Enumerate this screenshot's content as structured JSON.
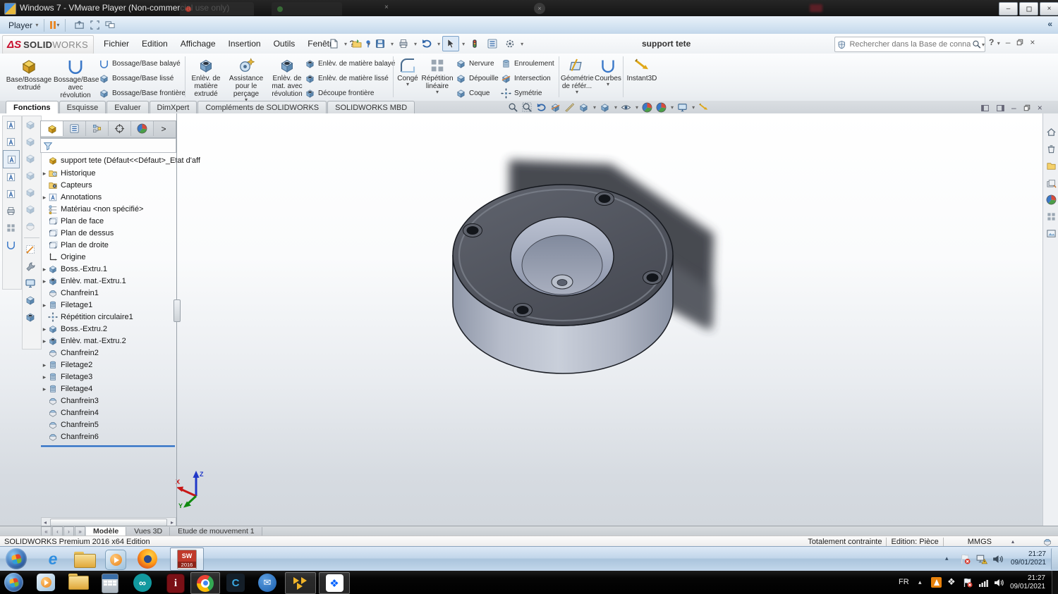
{
  "vmware": {
    "window_title": "Windows 7 - VMware Player (Non-commercial use only)",
    "player_menu": "Player"
  },
  "logo": {
    "mark": "ΔS",
    "bold": "SOLID",
    "light": "WORKS"
  },
  "menubar": {
    "menus": [
      "Fichier",
      "Edition",
      "Affichage",
      "Insertion",
      "Outils",
      "Fenêtre",
      "?"
    ],
    "doc_title": "support tete",
    "search_placeholder": "Rechercher dans la Base de connaissances"
  },
  "ribbon": {
    "large": [
      {
        "label": "Base/Bossage extrudé"
      },
      {
        "label": "Bossage/Base avec révolution"
      },
      {
        "label": "Enlèv. de matière extrudé"
      },
      {
        "label": "Assistance pour le perçage"
      },
      {
        "label": "Enlèv. de mat. avec révolution"
      },
      {
        "label": "Congé"
      },
      {
        "label": "Répétition linéaire"
      },
      {
        "label": "Géométrie de référ..."
      },
      {
        "label": "Courbes"
      },
      {
        "label": "Instant3D"
      }
    ],
    "small": [
      "Bossage/Base balayé",
      "Bossage/Base lissé",
      "Bossage/Base frontière",
      "Enlèv. de matière balayé",
      "Enlèv. de matière lissé",
      "Découpe frontière",
      "Nervure",
      "Dépouille",
      "Coque",
      "Enroulement",
      "Intersection",
      "Symétrie"
    ]
  },
  "command_tabs": [
    "Fonctions",
    "Esquisse",
    "Evaluer",
    "DimXpert",
    "Compléments de SOLIDWORKS",
    "SOLIDWORKS MBD"
  ],
  "tree": {
    "root": "support tete  (Défaut<<Défaut>_Etat d'aff",
    "items": [
      {
        "label": "Historique"
      },
      {
        "label": "Capteurs"
      },
      {
        "label": "Annotations"
      },
      {
        "label": "Matériau <non spécifié>"
      },
      {
        "label": "Plan de face"
      },
      {
        "label": "Plan de dessus"
      },
      {
        "label": "Plan de droite"
      },
      {
        "label": "Origine"
      },
      {
        "label": "Boss.-Extru.1"
      },
      {
        "label": "Enlèv. mat.-Extru.1"
      },
      {
        "label": "Chanfrein1"
      },
      {
        "label": "Filetage1"
      },
      {
        "label": "Répétition circulaire1"
      },
      {
        "label": "Boss.-Extru.2"
      },
      {
        "label": "Enlèv. mat.-Extru.2"
      },
      {
        "label": "Chanfrein2"
      },
      {
        "label": "Filetage2"
      },
      {
        "label": "Filetage3"
      },
      {
        "label": "Filetage4"
      },
      {
        "label": "Chanfrein3"
      },
      {
        "label": "Chanfrein4"
      },
      {
        "label": "Chanfrein5"
      },
      {
        "label": "Chanfrein6"
      }
    ]
  },
  "doc_tabs": [
    "Modèle",
    "Vues 3D",
    "Etude de mouvement 1"
  ],
  "statusbar": {
    "left": "SOLIDWORKS Premium 2016 x64 Edition",
    "constraint": "Totalement contrainte",
    "mode": "Edition: Pièce",
    "units": "MMGS"
  },
  "guest_taskbar": {
    "time": "21:27",
    "date": "09/01/2021",
    "ie": "e"
  },
  "host_taskbar": {
    "lang": "FR",
    "time": "21:27",
    "date": "09/01/2021",
    "arduino": "∞",
    "installer": "i",
    "cura": "C"
  },
  "sw_app": {
    "badge": "SW",
    "year": "2016"
  },
  "triad": {
    "x": "X",
    "y": "Y",
    "z": "Z"
  },
  "icons": {
    "dropdown": "▾",
    "tree_expand": "▸",
    "tray_up": "▴",
    "chevron_collapse": "«",
    "minimize": "–",
    "close": "×",
    "help": "?",
    "chevron_right": ">",
    "scroll_left": "◂",
    "scroll_right": "▸",
    "nav_first": "«",
    "nav_prev": "‹",
    "nav_next": "›",
    "nav_last": "»",
    "diamond": "❖",
    "mail": "✉"
  },
  "colors": {
    "accent_blue": "#2e7bc0",
    "brand_red": "#c8102e",
    "rollback_blue": "#2f6fc3"
  }
}
